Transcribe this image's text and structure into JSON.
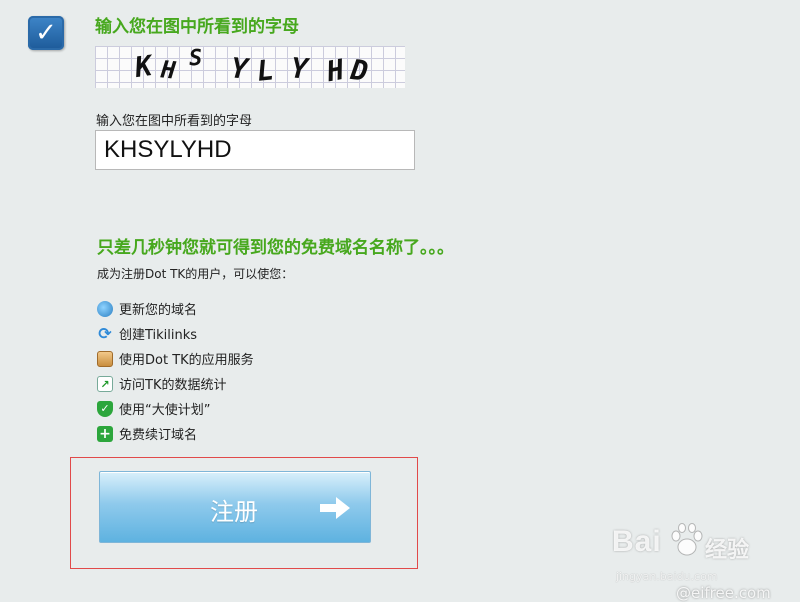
{
  "captcha": {
    "heading": "输入您在图中所看到的字母",
    "image_chars": [
      "K",
      "H",
      "S",
      "Y",
      "L",
      "Y",
      "H",
      "D"
    ],
    "field_label": "输入您在图中所看到的字母",
    "value": "KHSYLYHD"
  },
  "promo": {
    "title": "只差几秒钟您就可得到您的免费域名名称了。。。",
    "intro": "成为注册Dot TK的用户，可以使您：",
    "benefits": [
      {
        "icon": "globe-icon",
        "label": "更新您的域名"
      },
      {
        "icon": "link-icon",
        "label": "创建Tikilinks"
      },
      {
        "icon": "box-icon",
        "label": "使用Dot TK的应用服务"
      },
      {
        "icon": "chart-icon",
        "label": "访问TK的数据统计"
      },
      {
        "icon": "shield-check-icon",
        "label": "使用“大使计划”"
      },
      {
        "icon": "plus-icon",
        "label": "免费续订域名"
      }
    ]
  },
  "register": {
    "label": "注册"
  },
  "colors": {
    "heading_green": "#47a81e",
    "checkbox_blue": "#2b6aa8",
    "button_blue": "#5eb2e0",
    "highlight_red": "#e14a4a"
  },
  "watermark": {
    "logo": "Bai",
    "logo_cn": "经验",
    "url": "jingyan.baidu.com",
    "site": "eifree.com"
  }
}
